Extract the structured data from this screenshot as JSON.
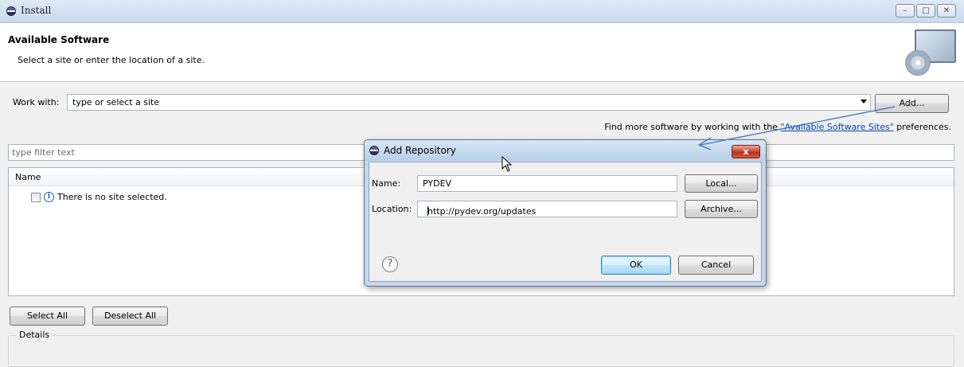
{
  "window": {
    "title": "Install",
    "controls": [
      "minimize-icon",
      "maximize-icon",
      "close-icon"
    ]
  },
  "header": {
    "title": "Available Software",
    "description": "Select a site or enter the location of a site."
  },
  "work_with": {
    "label": "Work with:",
    "value": "type or select a site",
    "add_button": "Add..."
  },
  "find_more": {
    "prefix": "Find more software by working with the ",
    "link": "\"Available Software Sites\"",
    "suffix": " preferences."
  },
  "filter": {
    "placeholder": "type filter text"
  },
  "tree": {
    "column_header": "Name",
    "rows": [
      {
        "text": "There is no site selected.",
        "checked": false
      }
    ]
  },
  "buttons": {
    "select_all": "Select All",
    "deselect_all": "Deselect All"
  },
  "details": {
    "label": "Details"
  },
  "dialog": {
    "title": "Add Repository",
    "close_label": "x",
    "name_label": "Name:",
    "name_value": "PYDEV",
    "location_label": "Location:",
    "location_value": "http://pydev.org/updates",
    "local_button": "Local...",
    "archive_button": "Archive...",
    "ok_button": "OK",
    "cancel_button": "Cancel",
    "help_glyph": "?"
  },
  "colors": {
    "link": "#0645ad",
    "annotation_arrow": "#3a6fbf",
    "close_red": "#c7482f"
  }
}
